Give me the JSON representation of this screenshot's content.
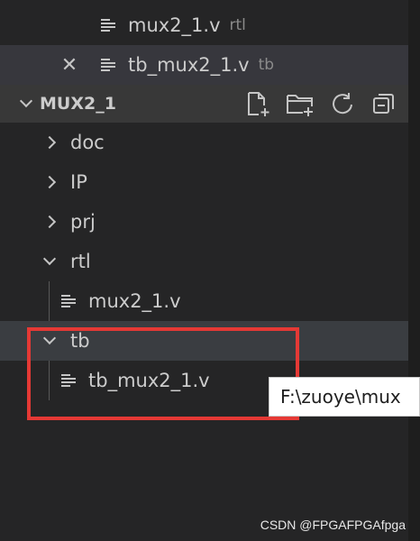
{
  "open_editors": [
    {
      "name": "mux2_1.v",
      "folder": "rtl",
      "active": false
    },
    {
      "name": "tb_mux2_1.v",
      "folder": "tb",
      "active": true,
      "close_glyph": "✕"
    }
  ],
  "explorer": {
    "section_title": "MUX2_1",
    "actions": [
      "new-file-icon",
      "new-folder-icon",
      "refresh-icon",
      "collapse-all-icon"
    ],
    "tree": [
      {
        "label": "doc",
        "type": "folder",
        "expanded": false
      },
      {
        "label": "IP",
        "type": "folder",
        "expanded": false
      },
      {
        "label": "prj",
        "type": "folder",
        "expanded": false
      },
      {
        "label": "rtl",
        "type": "folder",
        "expanded": true
      },
      {
        "label": "mux2_1.v",
        "type": "file"
      },
      {
        "label": "tb",
        "type": "folder",
        "expanded": true
      },
      {
        "label": "tb_mux2_1.v",
        "type": "file"
      }
    ]
  },
  "tooltip": {
    "text": "F:\\zuoye\\mux"
  },
  "watermark": "CSDN @FPGAFPGAfpga",
  "colors": {
    "highlight": "#e53935",
    "sidebar_bg": "#252526"
  }
}
